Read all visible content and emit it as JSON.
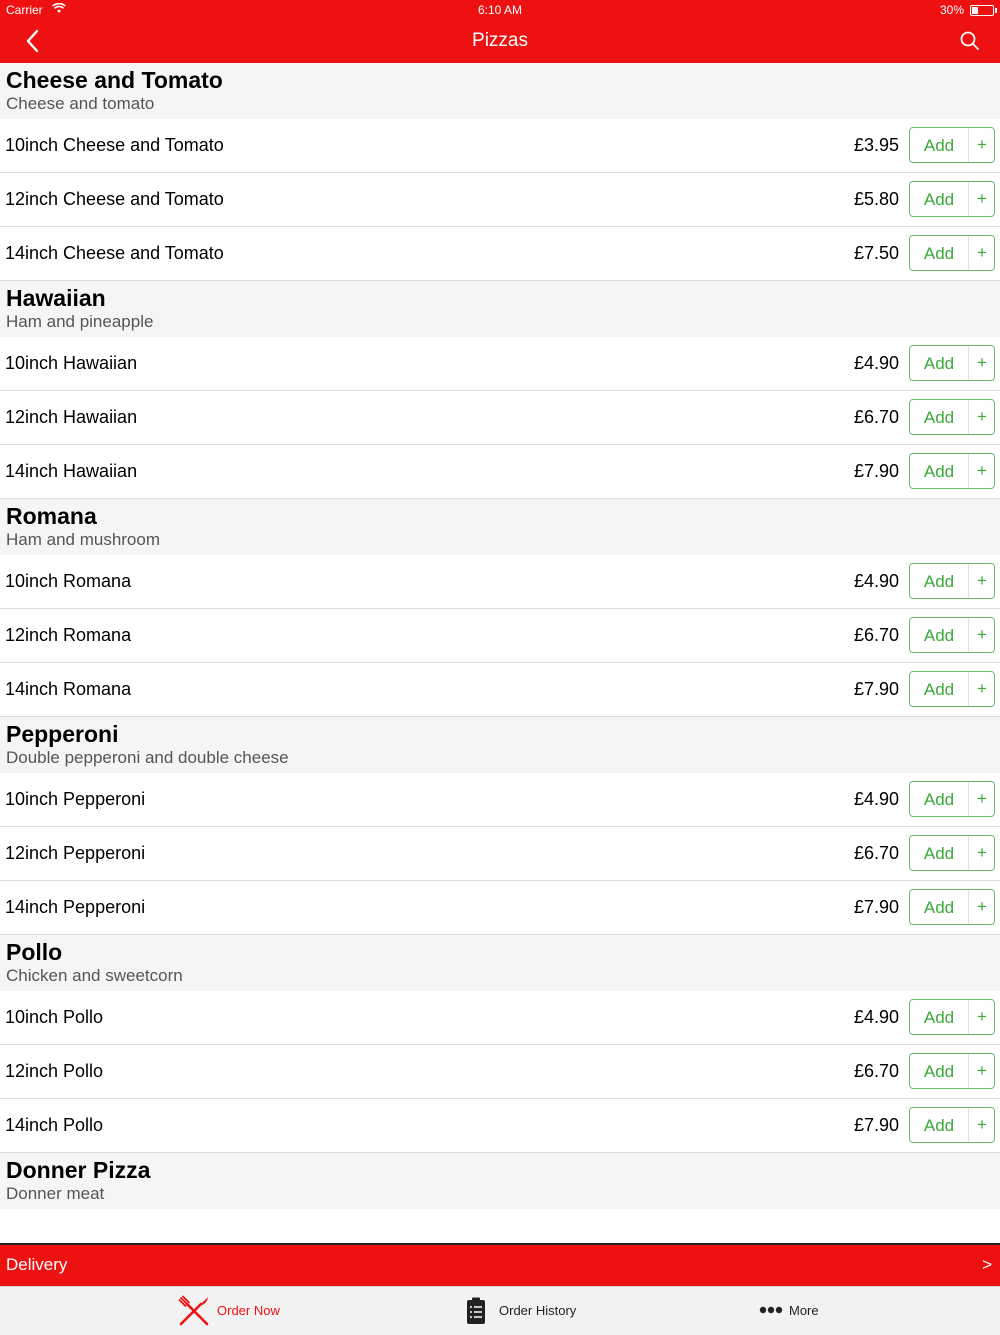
{
  "status_bar": {
    "carrier": "Carrier",
    "time": "6:10 AM",
    "battery": "30%"
  },
  "navbar": {
    "title": "Pizzas",
    "back_icon": "chevron-left-icon",
    "search_icon": "search-icon"
  },
  "add_label": "Add",
  "add_plus": "+",
  "sections": [
    {
      "name": "Cheese and Tomato",
      "description": "Cheese and tomato",
      "items": [
        {
          "name": "10inch Cheese and Tomato",
          "price": "£3.95"
        },
        {
          "name": "12inch Cheese and Tomato",
          "price": "£5.80"
        },
        {
          "name": "14inch Cheese and Tomato",
          "price": "£7.50"
        }
      ]
    },
    {
      "name": "Hawaiian",
      "description": "Ham and pineapple",
      "items": [
        {
          "name": "10inch Hawaiian",
          "price": "£4.90"
        },
        {
          "name": "12inch Hawaiian",
          "price": "£6.70"
        },
        {
          "name": "14inch Hawaiian",
          "price": "£7.90"
        }
      ]
    },
    {
      "name": "Romana",
      "description": "Ham and mushroom",
      "items": [
        {
          "name": "10inch Romana",
          "price": "£4.90"
        },
        {
          "name": "12inch Romana",
          "price": "£6.70"
        },
        {
          "name": "14inch Romana",
          "price": "£7.90"
        }
      ]
    },
    {
      "name": "Pepperoni",
      "description": "Double pepperoni and double cheese",
      "items": [
        {
          "name": "10inch Pepperoni",
          "price": "£4.90"
        },
        {
          "name": "12inch Pepperoni",
          "price": "£6.70"
        },
        {
          "name": "14inch Pepperoni",
          "price": "£7.90"
        }
      ]
    },
    {
      "name": "Pollo",
      "description": "Chicken and sweetcorn",
      "items": [
        {
          "name": "10inch Pollo",
          "price": "£4.90"
        },
        {
          "name": "12inch Pollo",
          "price": "£6.70"
        },
        {
          "name": "14inch Pollo",
          "price": "£7.90"
        }
      ]
    },
    {
      "name": "Donner Pizza",
      "description": "Donner meat",
      "items": []
    }
  ],
  "delivery_bar": {
    "label": "Delivery",
    "arrow": ">"
  },
  "tabs": [
    {
      "label": "Order Now",
      "icon": "fork-knife-icon",
      "active": true
    },
    {
      "label": "Order History",
      "icon": "clipboard-list-icon",
      "active": false
    },
    {
      "label": "More",
      "icon": "more-dots-icon",
      "active": false
    }
  ],
  "colors": {
    "brand_red": "#ee1111",
    "add_green": "#3aa83a",
    "section_bg": "#f5f5f5"
  }
}
